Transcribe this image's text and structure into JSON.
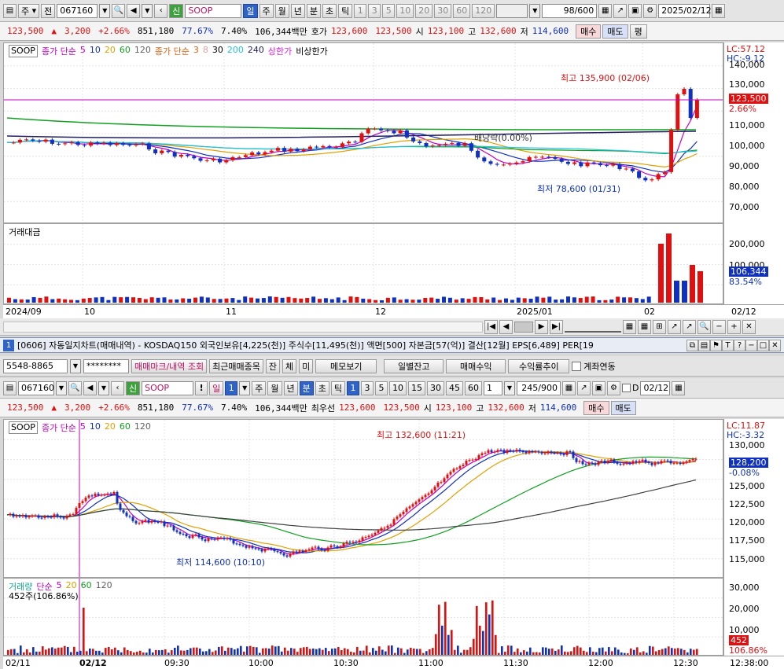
{
  "top": {
    "toolbar": {
      "market": "주",
      "period_btn": "전",
      "code": "067160",
      "name": "SOOP",
      "badge": "신",
      "intervals": [
        "일",
        "주",
        "월",
        "년",
        "분",
        "초",
        "틱"
      ],
      "numbers": [
        "1",
        "3",
        "5",
        "10",
        "20",
        "30",
        "60",
        "120"
      ],
      "count": "98",
      "count_total": "/600",
      "date": "2025/02/12"
    },
    "quote": {
      "price": "123,500",
      "arrow": "▲",
      "change": "3,200",
      "pct": "+2.66%",
      "volume": "851,180",
      "ratio1": "77.67%",
      "ratio2": "7.40%",
      "amount": "106,344백만",
      "bid_label": "호가",
      "bid": "123,600",
      "ask": "123,500",
      "open_label": "시",
      "open": "123,100",
      "high_label": "고",
      "high": "132,600",
      "low_label": "저",
      "low": "114,600",
      "buy": "매수",
      "sell": "매도",
      "flat": "평"
    },
    "legend": {
      "symbol": "SOOP",
      "close_label": "종가 단순",
      "ma1": "5",
      "ma2": "10",
      "ma3": "20",
      "ma4": "60",
      "ma5": "120",
      "close_label2": "종가 단순",
      "ma6": "3",
      "ma7": "8",
      "ma8": "30",
      "ma9": "200",
      "ma10": "240",
      "upper": "상한가",
      "nonupper": "비상한가"
    },
    "lc": "LC:57.12",
    "hc": "HC:-9.12",
    "price_ticks": [
      "140,000",
      "130,000",
      "120,000",
      "110,000",
      "100,000",
      "90,000",
      "80,000",
      "70,000"
    ],
    "price_tag": "123,500",
    "price_tag_pct": "2.66%",
    "high_annot": "최고 135,900 (02/06)",
    "low_annot": "최저 78,600 (01/31)",
    "dividend": "배당락(0.00%)",
    "vol_label": "거래대금",
    "vol_ticks": [
      "200,000",
      "100,000"
    ],
    "vol_tag": "106,344",
    "vol_tag_pct": "83.54%",
    "x_labels": [
      "2024/09",
      "10",
      "11",
      "12",
      "2025/01",
      "02"
    ],
    "x_right": "02/12"
  },
  "window": {
    "num": "1",
    "title": "[0606] 자동일지차트(매매내역) - KOSDAQ150 외국인보유[4,225(천)] 주식수[11,495(천)] 액면[500] 자본금[57(억)] 결산[12월] EPS[6,489] PER[19"
  },
  "account": {
    "number": "5548-8865",
    "password": "********",
    "btn1": "매매마크/내역 조회",
    "btn2": "최근매매종목",
    "btn3": "잔",
    "btn4": "체",
    "btn5": "미",
    "btn6": "메모보기",
    "btn7": "일별잔고",
    "btn8": "매매수익",
    "btn9": "수익률추이",
    "check": "계좌연동"
  },
  "bottom": {
    "toolbar": {
      "code": "067160",
      "name": "SOOP",
      "badge": "신",
      "excl": "!",
      "day": "일",
      "day_num": "1",
      "intervals": [
        "주",
        "월",
        "년",
        "분",
        "초",
        "틱"
      ],
      "numbers": [
        "1",
        "3",
        "5",
        "10",
        "15",
        "30",
        "45",
        "60"
      ],
      "sel_num": "1",
      "count": "245",
      "count_total": "/900",
      "d_label": "D",
      "date": "02/12"
    },
    "quote": {
      "price": "123,500",
      "arrow": "▲",
      "change": "3,200",
      "pct": "+2.66%",
      "volume": "851,180",
      "ratio1": "77.67%",
      "ratio2": "7.40%",
      "amount": "106,344백만",
      "bid_label": "최우선",
      "bid": "123,600",
      "ask": "123,500",
      "open_label": "시",
      "open": "123,100",
      "high_label": "고",
      "high": "132,600",
      "low_label": "저",
      "low": "114,600",
      "buy": "매수",
      "sell": "매도"
    },
    "legend": {
      "symbol": "SOOP",
      "close_label": "종가 단순",
      "ma1": "5",
      "ma2": "10",
      "ma3": "20",
      "ma4": "60",
      "ma5": "120"
    },
    "lc": "LC:11.87",
    "hc": "HC:-3.32",
    "price_ticks": [
      "130,000",
      "127,500",
      "125,000",
      "122,500",
      "120,000",
      "117,500",
      "115,000"
    ],
    "price_tag": "128,200",
    "price_tag_pct": "-0.08%",
    "high_annot": "최고 132,600 (11:21)",
    "low_annot": "최저 114,600 (10:10)",
    "vol_label": "거래량",
    "vol_ma_label": "단순",
    "vol_ma1": "5",
    "vol_ma2": "20",
    "vol_ma3": "60",
    "vol_ma4": "120",
    "vol_current": "452주(106.86%)",
    "vol_ticks": [
      "30,000",
      "20,000",
      "10,000"
    ],
    "vol_tag": "452",
    "vol_tag_pct": "106.86%",
    "x_labels": [
      "02/11",
      "02/12",
      "09:30",
      "10:00",
      "10:30",
      "11:00",
      "11:30",
      "12:00",
      "12:30"
    ],
    "x_right": "12:38:00"
  },
  "colors": {
    "up": "#e01010",
    "down": "#1030c0",
    "ma5": "#c000c0",
    "ma10": "#1030c0",
    "ma20": "#e0a000",
    "ma60": "#10a020",
    "ma120": "#404040",
    "cyan": "#20c0e0",
    "navy": "#202060",
    "highline": "#c000c0"
  }
}
